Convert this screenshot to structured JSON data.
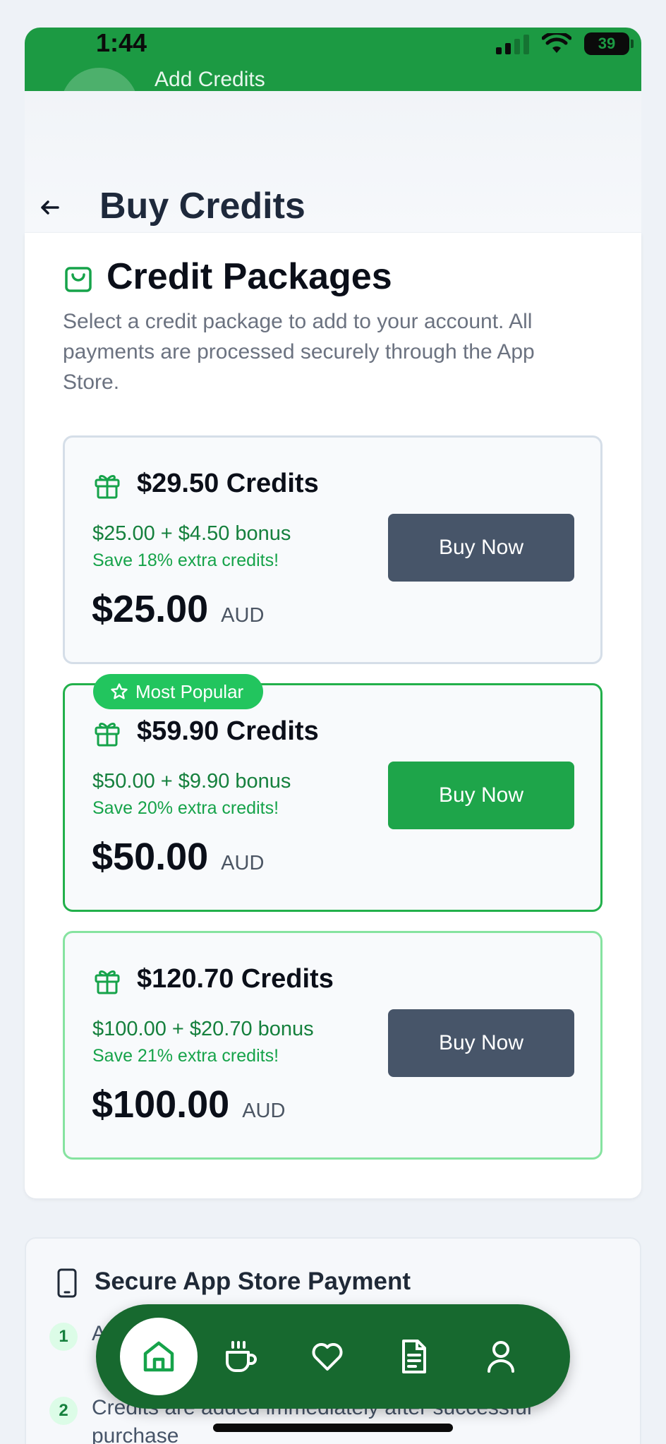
{
  "status_bar": {
    "time": "1:44",
    "battery": "39"
  },
  "underlying_header": {
    "title": "Add Credits"
  },
  "header": {
    "title": "Buy Credits"
  },
  "section": {
    "title": "Credit Packages",
    "description": "Select a credit package to add to your account. All payments are processed securely through the App Store."
  },
  "packages": [
    {
      "title": "$29.50 Credits",
      "bonus": "$25.00 + $4.50 bonus",
      "save": "Save 18% extra credits!",
      "price": "$25.00",
      "currency": "AUD",
      "button": "Buy Now"
    },
    {
      "title": "$59.90 Credits",
      "bonus": "$50.00 + $9.90 bonus",
      "save": "Save 20% extra credits!",
      "price": "$50.00",
      "currency": "AUD",
      "button": "Buy Now",
      "badge": "Most Popular"
    },
    {
      "title": "$120.70 Credits",
      "bonus": "$100.00 + $20.70 bonus",
      "save": "Save 21% extra credits!",
      "price": "$100.00",
      "currency": "AUD",
      "button": "Buy Now"
    }
  ],
  "secure": {
    "title": "Secure App Store Payment",
    "steps": [
      {
        "num": "1",
        "text": "A"
      },
      {
        "num": "2",
        "text": "Credits are added immediately after successful purchase"
      }
    ]
  },
  "nav": {
    "items": [
      "home-icon",
      "coffee-icon",
      "heart-icon",
      "document-icon",
      "user-icon"
    ]
  },
  "colors": {
    "primary": "#1c9a43",
    "dark_green": "#17692f",
    "button_slate": "#475569"
  }
}
